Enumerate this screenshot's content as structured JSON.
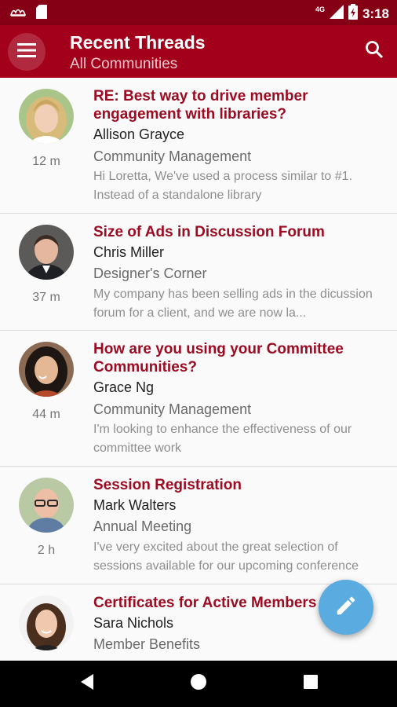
{
  "status_bar": {
    "network": "4G",
    "time": "3:18",
    "icons": [
      "notification-icon",
      "sd-card-icon",
      "signal-icon",
      "battery-icon"
    ]
  },
  "app_bar": {
    "title": "Recent Threads",
    "subtitle": "All Communities",
    "icons": [
      "menu-icon",
      "search-icon"
    ]
  },
  "threads": [
    {
      "title": "RE: Best way to drive member engagement with libraries?",
      "author": "Allison Grayce",
      "community": "Community Management",
      "snippet": "Hi Loretta, We've used a process similar to #1. Instead of a standalone library",
      "time": "12 m"
    },
    {
      "title": "Size of Ads in Discussion Forum",
      "author": "Chris Miller",
      "community": "Designer's Corner",
      "snippet": "My company has been selling ads in the dicussion forum for a client, and we are now la...",
      "time": "37 m"
    },
    {
      "title": "How are you using your Committee Communities?",
      "author": "Grace Ng",
      "community": "Community Management",
      "snippet": "I'm looking to enhance the effectiveness of our committee work",
      "time": "44 m"
    },
    {
      "title": "Session Registration",
      "author": "Mark Walters",
      "community": "Annual Meeting",
      "snippet": "I've very excited about the great selection of sessions available for our upcoming conference",
      "time": "2 h"
    },
    {
      "title": "Certificates for Active Members",
      "author": "Sara Nichols",
      "community": "Member Benefits",
      "snippet": "",
      "time": ""
    }
  ],
  "fab": {
    "icon": "pencil-icon"
  },
  "nav_bar": {
    "icons": [
      "back-icon",
      "home-icon",
      "recents-icon"
    ]
  },
  "colors": {
    "status_bar": "#860015",
    "app_bar": "#a3001b",
    "thread_title": "#9c0b22",
    "fab": "#5aabe0"
  }
}
